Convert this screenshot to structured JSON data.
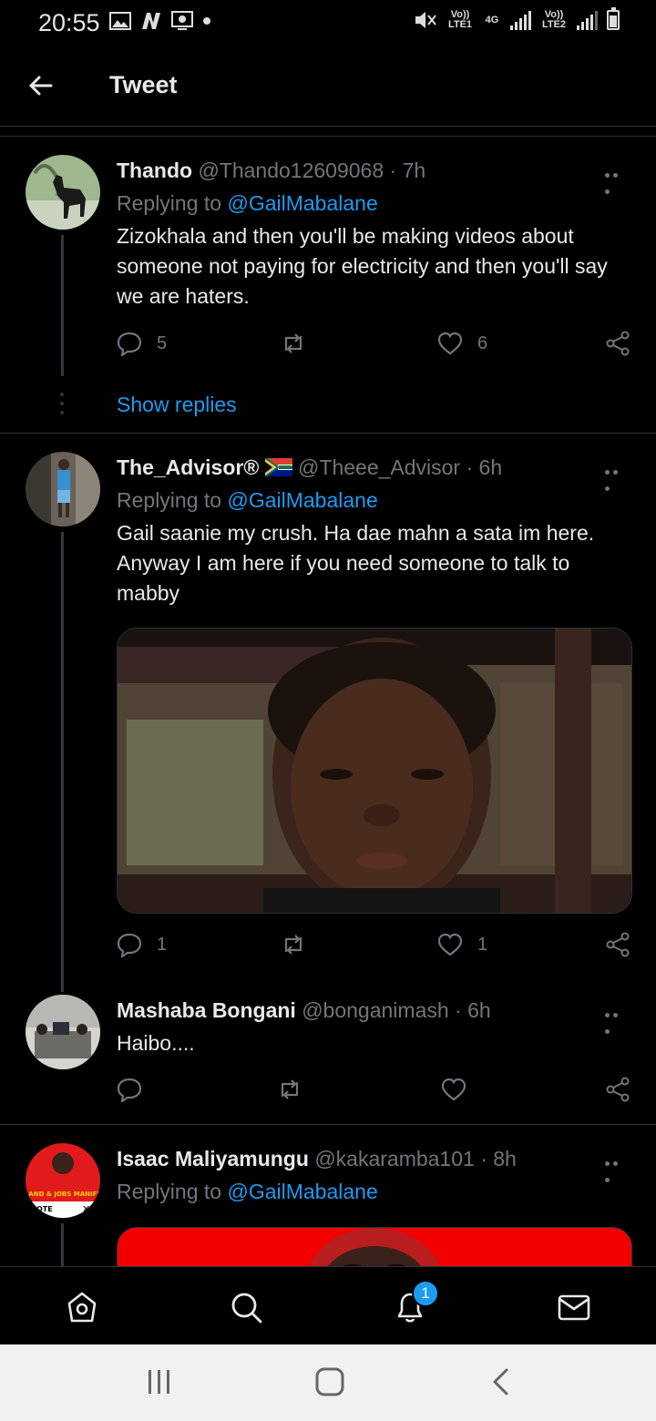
{
  "status_bar": {
    "time": "20:55",
    "sim1": "Vo)) LTE1",
    "net": "4G",
    "sim2": "Vo)) LTE2"
  },
  "header": {
    "title": "Tweet"
  },
  "tweets": [
    {
      "name": "Thando",
      "handle": "@Thando12609068 · 7h",
      "replying_prefix": "Replying to ",
      "replying_to": "@GailMabalane",
      "text": "Zizokhala and then you'll be making videos about someone not paying for electricity and then you'll say we are haters.",
      "replies": "5",
      "retweets": "",
      "likes": "6"
    },
    {
      "name": "The_Advisor®",
      "handle": "@Theee_Advisor · 6h",
      "replying_prefix": "Replying to ",
      "replying_to": "@GailMabalane",
      "text": "Gail saanie my crush. Ha dae mahn a sata im here. Anyway I am here if you need someone to talk to mabby",
      "replies": "1",
      "retweets": "",
      "likes": "1"
    },
    {
      "name": "Mashaba Bongani",
      "handle": "@bonganimash · 6h",
      "text": "Haibo....",
      "replies": "",
      "retweets": "",
      "likes": ""
    },
    {
      "name": "Isaac Maliyamungu",
      "handle": "@kakaramba101 · 8h",
      "replying_prefix": "Replying to ",
      "replying_to": "@GailMabalane",
      "avatar_text": "LAND & JOBS MANIFE",
      "avatar_subtext": "OTE"
    }
  ],
  "show_replies": "Show replies",
  "bottom_nav": {
    "notifications_badge": "1"
  },
  "icons": {
    "back": "arrow-left-icon",
    "reply": "speech-bubble-icon",
    "retweet": "retweet-icon",
    "like": "heart-icon",
    "share": "share-icon",
    "more": "more-horizontal-icon",
    "home": "home-icon",
    "search": "search-icon",
    "notifications": "bell-icon",
    "messages": "mail-icon"
  },
  "colors": {
    "accent": "#1d9bf0",
    "background": "#000000",
    "muted": "#71767b"
  }
}
